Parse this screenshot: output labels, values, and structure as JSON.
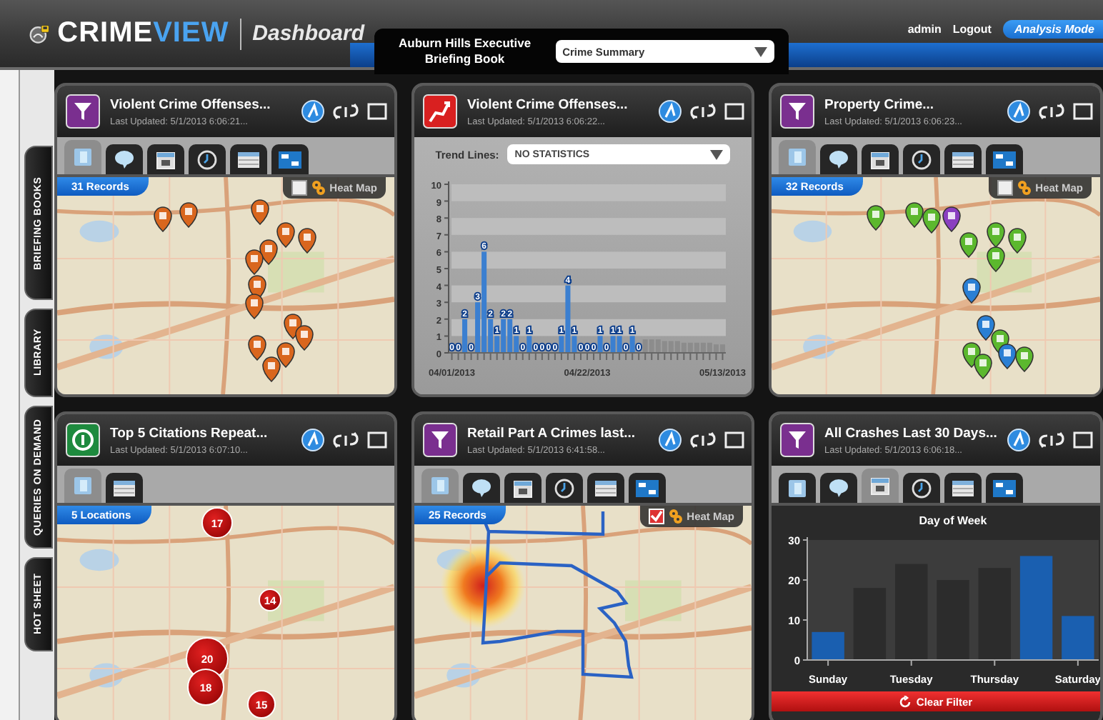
{
  "header": {
    "logo": {
      "part_1": "CRIME",
      "part_2": "VIEW"
    },
    "app_name": "Dashboard",
    "book_title": "Auburn Hills Executive Briefing Book",
    "book_select": {
      "value": "Crime Summary"
    },
    "user": "admin",
    "logout": "Logout",
    "mode_button": "Analysis Mode"
  },
  "side_tabs": [
    {
      "label": "BRIEFING BOOKS"
    },
    {
      "label": "LIBRARY"
    },
    {
      "label": "QUERIES ON DEMAND"
    },
    {
      "label": "HOT SHEET"
    }
  ],
  "widgets": [
    {
      "kind": "map",
      "title": "Violent Crime Offenses...",
      "updated": "Last Updated: 5/1/2013 6:06:21...",
      "tabs": [
        {
          "kind": "map",
          "selected": true
        },
        {
          "kind": "bubble",
          "selected": false
        },
        {
          "kind": "calendar",
          "selected": false
        },
        {
          "kind": "clock",
          "selected": false
        },
        {
          "kind": "table",
          "selected": false
        },
        {
          "kind": "pivot",
          "selected": false
        }
      ],
      "count": "31 Records",
      "heat_map": {
        "label": "Heat Map",
        "checked": false
      }
    },
    {
      "kind": "chart",
      "title": "Violent Crime Offenses...",
      "updated": "Last Updated: 5/1/2013 6:06:22...",
      "trend": {
        "label": "Trend Lines:",
        "value": "NO STATISTICS"
      },
      "chart_data": {
        "type": "bar",
        "categories": [
          "04/01/2013",
          null,
          null,
          null,
          null,
          null,
          null,
          null,
          null,
          null,
          null,
          null,
          null,
          null,
          null,
          null,
          null,
          null,
          null,
          null,
          null,
          "04/22/2013",
          null,
          null,
          null,
          null,
          null,
          null,
          null,
          null,
          null,
          null,
          null,
          null,
          null,
          null,
          null,
          null,
          null,
          null,
          null,
          null,
          "05/13/2013"
        ],
        "series": [
          {
            "color": "#3b7fd0",
            "values": [
              0,
              0,
              2,
              0,
              3,
              6,
              2,
              1,
              2,
              2,
              1,
              0,
              1,
              0,
              0,
              0,
              0,
              1,
              4,
              1,
              0,
              0,
              0,
              1,
              0,
              1,
              1,
              0,
              1,
              0,
              null,
              null,
              null,
              null,
              null,
              null,
              null,
              null,
              null,
              null,
              null,
              null,
              null
            ]
          },
          {
            "color": "#8c8c8c",
            "values": [
              null,
              null,
              null,
              null,
              null,
              null,
              null,
              null,
              null,
              null,
              null,
              null,
              null,
              null,
              null,
              null,
              null,
              null,
              null,
              null,
              null,
              null,
              null,
              null,
              null,
              null,
              null,
              null,
              null,
              null,
              0.8,
              0.8,
              0.8,
              0.7,
              0.7,
              0.7,
              0.6,
              0.6,
              0.6,
              0.6,
              0.6,
              0.5,
              0.5
            ]
          }
        ],
        "stacked": true,
        "ylim": [
          0,
          10
        ],
        "yticks": [
          0,
          1,
          2,
          3,
          4,
          5,
          6,
          7,
          8,
          9,
          10
        ],
        "value_labels": [
          [
            "0",
            "0",
            "2",
            "0",
            "3",
            "6",
            "2",
            "1",
            "2",
            "2",
            "1",
            "0",
            "1",
            "0",
            "0",
            "0",
            "0",
            "1",
            "4",
            "1",
            "0",
            "0",
            "0",
            "1",
            "0",
            "1",
            "1",
            "0",
            "1",
            "0",
            null,
            null,
            null,
            null,
            null,
            null,
            null,
            null,
            null,
            null,
            null,
            null,
            null
          ],
          [
            null,
            null,
            null,
            null,
            null,
            null,
            null,
            null,
            null,
            null,
            null,
            null,
            null,
            null,
            null,
            null,
            null,
            null,
            null,
            null,
            null,
            null,
            null,
            null,
            null,
            null,
            null,
            null,
            null,
            null,
            null,
            null,
            null,
            null,
            null,
            null,
            null,
            null,
            null,
            null,
            null,
            null,
            null
          ]
        ]
      }
    },
    {
      "kind": "map",
      "title": "Property Crime...",
      "updated": "Last Updated: 5/1/2013 6:06:23...",
      "tabs": [
        {
          "kind": "map",
          "selected": true
        },
        {
          "kind": "bubble",
          "selected": false
        },
        {
          "kind": "calendar",
          "selected": false
        },
        {
          "kind": "clock",
          "selected": false
        },
        {
          "kind": "table",
          "selected": false
        },
        {
          "kind": "pivot",
          "selected": false
        }
      ],
      "count": "32 Records",
      "heat_map": {
        "label": "Heat Map",
        "checked": false
      }
    },
    {
      "kind": "map",
      "title": "Top 5 Citations Repeat...",
      "updated": "Last Updated: 5/1/2013 6:07:10...",
      "tabs": [
        {
          "kind": "map",
          "selected": true
        },
        {
          "kind": "table",
          "selected": false
        }
      ],
      "count": "5 Locations",
      "clusters": [
        "17",
        "14",
        "20",
        "18",
        "15"
      ]
    },
    {
      "kind": "map",
      "title": "Retail Part A Crimes last...",
      "updated": "Last Updated: 5/1/2013 6:41:58...",
      "tabs": [
        {
          "kind": "map",
          "selected": true
        },
        {
          "kind": "bubble",
          "selected": false
        },
        {
          "kind": "calendar",
          "selected": false
        },
        {
          "kind": "clock",
          "selected": false
        },
        {
          "kind": "table",
          "selected": false
        },
        {
          "kind": "pivot",
          "selected": false
        }
      ],
      "count": "25 Records",
      "heat_map": {
        "label": "Heat Map",
        "checked": true
      }
    },
    {
      "kind": "chart",
      "title": "All Crashes Last 30 Days...",
      "updated": "Last Updated: 5/1/2013 6:06:18...",
      "tabs": [
        {
          "kind": "map",
          "selected": false
        },
        {
          "kind": "bubble",
          "selected": false
        },
        {
          "kind": "calendar",
          "selected": true
        },
        {
          "kind": "clock",
          "selected": false
        },
        {
          "kind": "table",
          "selected": false
        },
        {
          "kind": "pivot",
          "selected": false
        }
      ],
      "chart_data": {
        "type": "bar",
        "title": "Day of Week",
        "categories": [
          "Sunday",
          null,
          "Tuesday",
          null,
          "Thursday",
          null,
          "Saturday"
        ],
        "series": [
          {
            "color": "#1a5fb0",
            "values": [
              7,
              null,
              null,
              null,
              null,
              26,
              11
            ]
          },
          {
            "color": "#2c2c2c",
            "values": [
              null,
              18,
              24,
              20,
              23,
              null,
              null
            ]
          }
        ],
        "stacked": true,
        "ylim": [
          0,
          30
        ],
        "yticks": [
          0,
          10,
          20,
          30
        ]
      },
      "clear_button": "Clear Filter"
    }
  ]
}
